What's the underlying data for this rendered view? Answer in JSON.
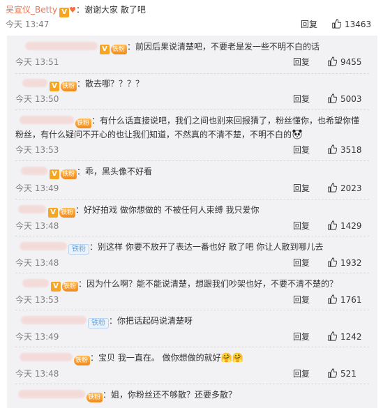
{
  "main_comment": {
    "username": "吴宣仪_Betty",
    "text": "：谢谢大家 散了吧",
    "time": "今天 13:47",
    "reply_label": "回复",
    "likes": "13463"
  },
  "replies": [
    {
      "badge": "gold",
      "text": "：前因后果说清楚吧，不要老是发一些不明不白的话",
      "time": "今天 13:51",
      "reply_label": "回复",
      "likes": "9455"
    },
    {
      "badge": "gold",
      "text": "：散去哪？？？？",
      "time": "今天 13:50",
      "reply_label": "回复",
      "likes": "5003"
    },
    {
      "badge": "gold",
      "text": "：有什么话直接说吧，我们之间也别来回报猜了，粉丝懂你，也希望你懂",
      "text2": "粉丝，有什么疑问不开心的也让我们知道，不然真的不清不楚，不明不白的",
      "time": "今天 13:53",
      "reply_label": "回复",
      "likes": "3518"
    },
    {
      "badge": "gold",
      "text": "：乖，黑头像不好看",
      "time": "今天 13:49",
      "reply_label": "回复",
      "likes": "2023"
    },
    {
      "badge": "gold",
      "text": "：好好拍戏 做你想做的 不被任何人束缚 我只爱你",
      "time": "今天 13:48",
      "reply_label": "回复",
      "likes": "1429"
    },
    {
      "badge": "blue",
      "text": "：别这样 你要不放开了表达一番也好 散了吧 你让人散到哪儿去",
      "time": "今天 13:48",
      "reply_label": "回复",
      "likes": "1932"
    },
    {
      "badge": "gold",
      "text": "：因为什么啊？能不能说清楚，想跟我们吵架也好，不要不清不楚的？",
      "time": "今天 13:53",
      "reply_label": "回复",
      "likes": "1761"
    },
    {
      "badge": "blue",
      "text": "：你把话起码说清楚呀",
      "time": "今天 13:49",
      "reply_label": "回复",
      "likes": "1242"
    },
    {
      "badge": "gold",
      "text": "：宝贝 我一直在。 做你想做的就好",
      "time": "今天 13:48",
      "reply_label": "回复",
      "likes": "521"
    },
    {
      "badge": "gold",
      "text": "：姐，你粉丝还不够散？还要多散？",
      "time": "",
      "reply_label": "",
      "likes": ""
    }
  ],
  "badges": {
    "vip_letter": "V",
    "gold_fan_label": "铁粉",
    "blue_fan_label": "铁粉"
  },
  "colors": {
    "username": "#eb7350",
    "thread_bg": "#f2f2f5",
    "gold_badge": "#f28a1c",
    "blue_badge": "#6aa6dc"
  }
}
